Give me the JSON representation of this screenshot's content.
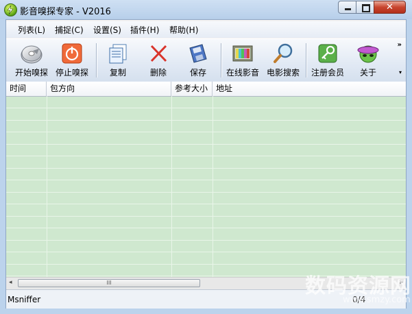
{
  "window": {
    "title": "影音嗅探专家 - V2016",
    "close_glyph": "✕"
  },
  "menu": [
    {
      "label": "列表(L)"
    },
    {
      "label": "捕捉(C)"
    },
    {
      "label": "设置(S)"
    },
    {
      "label": "插件(H)"
    },
    {
      "label": "帮助(H)"
    }
  ],
  "toolbar": {
    "overflow_glyph": "»",
    "dropdown_glyph": "▾",
    "buttons": [
      {
        "label": "开始嗅探",
        "icon": "disc-icon"
      },
      {
        "label": "停止嗅探",
        "icon": "power-icon"
      },
      {
        "label": "复制",
        "icon": "copy-icon"
      },
      {
        "label": "删除",
        "icon": "delete-icon"
      },
      {
        "label": "保存",
        "icon": "floppy-icon"
      },
      {
        "label": "在线影音",
        "icon": "tv-icon"
      },
      {
        "label": "电影搜索",
        "icon": "magnifier-icon"
      },
      {
        "label": "注册会员",
        "icon": "key-icon"
      },
      {
        "label": "关于",
        "icon": "alien-icon"
      }
    ]
  },
  "list": {
    "columns": [
      "时间",
      "包方向",
      "参考大小",
      "地址"
    ],
    "rows": []
  },
  "scrollbar": {
    "left_arrow": "◂",
    "right_arrow": "▸",
    "grip": "III"
  },
  "status": {
    "text": "Msniffer",
    "right_text": "0/4"
  },
  "watermark": {
    "text": "数码资源网",
    "url": "www.smzy.com"
  },
  "colors": {
    "list_bg": "#cfe8cf",
    "title_bg": "#bcd3ec",
    "close_btn": "#c8452f"
  }
}
